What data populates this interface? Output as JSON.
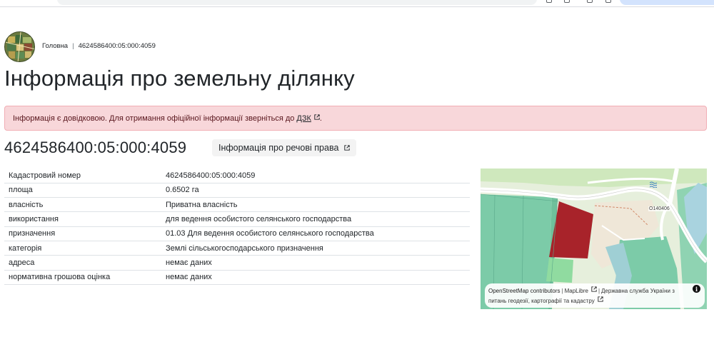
{
  "breadcrumb": {
    "home": "Головна",
    "current": "4624586400:05:000:4059"
  },
  "page_title": "Інформація про земельну ділянку",
  "alert": {
    "text": "Інформація є довідковою. Для отримання офіційної інформації зверніться до",
    "link": "ДЗК",
    "suffix": "."
  },
  "parcel": {
    "cadastral_number": "4624586400:05:000:4059",
    "rights_button": "Інформація про речові права"
  },
  "table": [
    {
      "key": "Кадастровий номер",
      "value": "4624586400:05:000:4059"
    },
    {
      "key": "площа",
      "value": "0.6502 га"
    },
    {
      "key": "власність",
      "value": "Приватна власність"
    },
    {
      "key": "використання",
      "value": "для ведення особистого селянського господарства"
    },
    {
      "key": "призначення",
      "value": "01.03 Для ведення особистого селянського господарства"
    },
    {
      "key": "категорія",
      "value": "Землі сільськогосподарського призначення"
    },
    {
      "key": "адреса",
      "value": "немає даних"
    },
    {
      "key": "нормативна грошова оцінка",
      "value": "немає даних"
    }
  ],
  "map": {
    "road_label": "О140406",
    "attribution": {
      "osm": "OpenStreetMap contributors",
      "maplibre": "MapLibre",
      "agency": "Державна служба України з питань геодезії, картографії та кадастру"
    },
    "colors": {
      "parcel_highlight": "#a8232a",
      "farmland": "#7ccba8",
      "meadow": "#cfe8bd",
      "road": "#ffffff",
      "water": "#a9d3df"
    }
  },
  "colors": {
    "alert_bg": "#f8d7da",
    "alert_text": "#58151c",
    "text": "#212529"
  }
}
